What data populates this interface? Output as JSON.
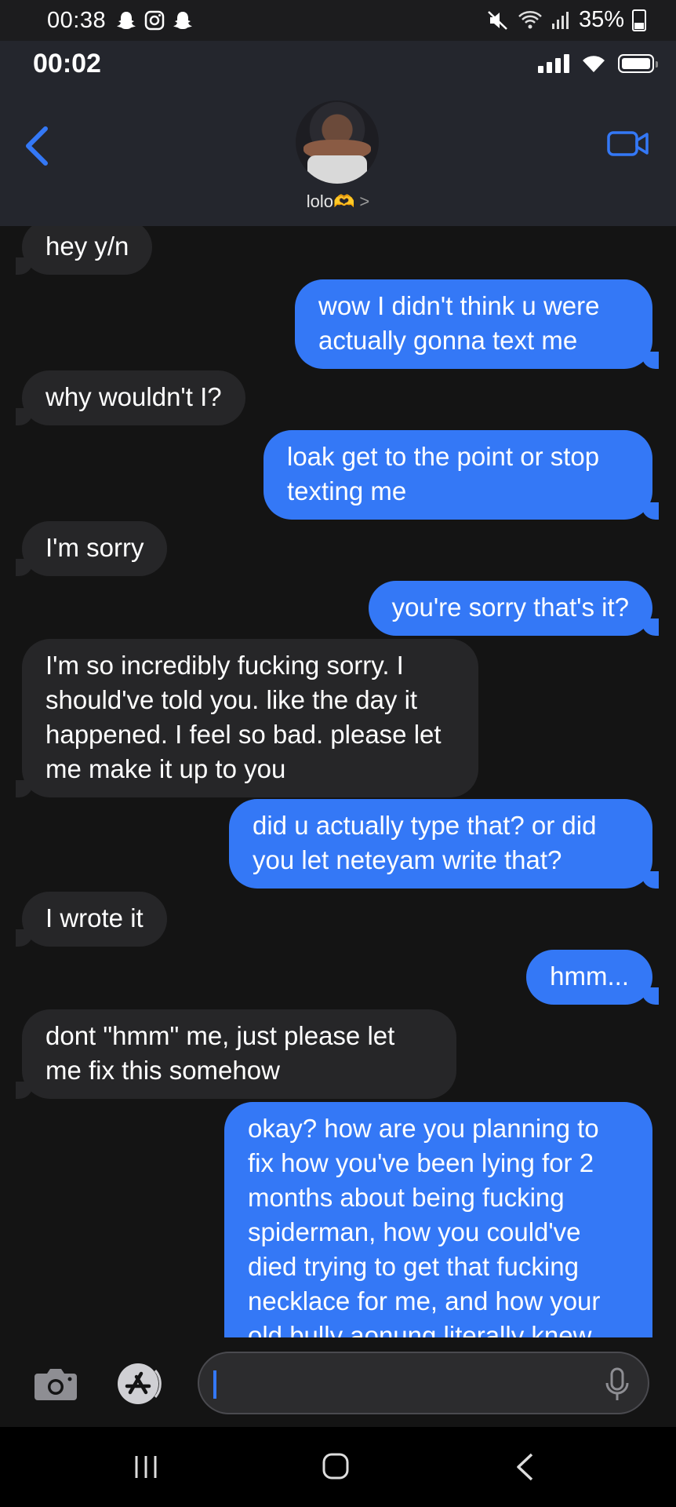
{
  "android_status": {
    "time": "00:38",
    "notification_icons": [
      "snapchat-icon",
      "instagram-icon",
      "snapchat-icon"
    ],
    "battery": "35%"
  },
  "ios_status": {
    "time": "00:02"
  },
  "header": {
    "contact_name": "lolo🫶",
    "chevron": ">"
  },
  "messages": [
    {
      "dir": "in",
      "text": "hey y/n"
    },
    {
      "dir": "out",
      "text": "wow I didn't think u were actually gonna text me"
    },
    {
      "dir": "in",
      "text": "why wouldn't I?"
    },
    {
      "dir": "out",
      "text": "loak get to the point or stop texting me"
    },
    {
      "dir": "in",
      "text": "I'm sorry"
    },
    {
      "dir": "out",
      "text": "you're sorry that's it?"
    },
    {
      "dir": "in",
      "text": "I'm so incredibly fucking sorry. I should've told you. like the day it happened. I feel so bad. please let me make it up to you"
    },
    {
      "dir": "out",
      "text": "did u actually type that? or did you let neteyam write that?"
    },
    {
      "dir": "in",
      "text": "I wrote it"
    },
    {
      "dir": "out",
      "text": "hmm..."
    },
    {
      "dir": "in",
      "text": "dont \"hmm\" me, just please let me fix this somehow"
    },
    {
      "dir": "out",
      "text": "okay? how are you planning to fix how you've been lying for 2 months about being fucking spiderman, how you could've died trying to get that fucking necklace for me, and how your old bully aonung literally knew"
    }
  ],
  "composer": {
    "value": ""
  },
  "colors": {
    "outgoing": "#3478f6",
    "incoming": "#262628",
    "accent": "#3478f6"
  }
}
